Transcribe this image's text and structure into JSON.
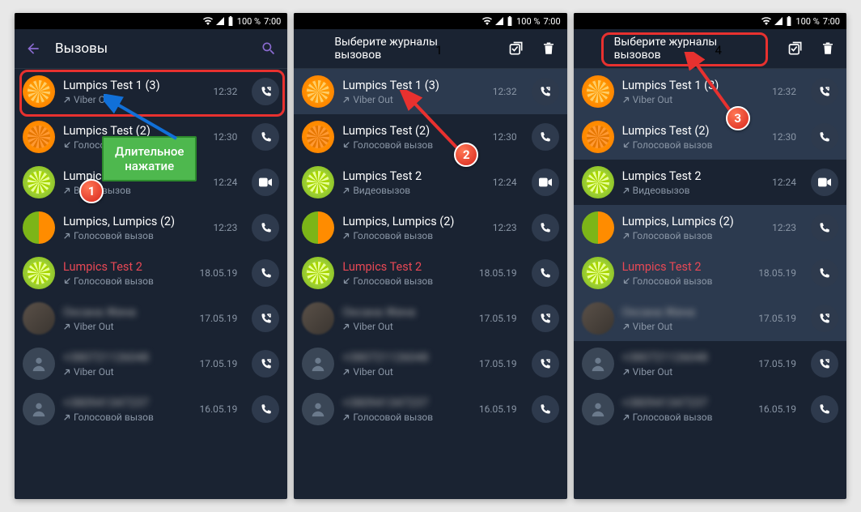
{
  "status": {
    "battery": "100 %",
    "time": "7:00"
  },
  "screens": [
    {
      "appbar": {
        "type": "calls",
        "title": "Вызовы"
      },
      "rows": [
        {
          "avatar": "orange",
          "title": "Lumpics Test 1 (3)",
          "sub": "Viber Out",
          "dir": "out",
          "time": "12:32",
          "btn": "viberout",
          "hl": true
        },
        {
          "avatar": "orange-dark",
          "title": "Lumpics Test (2)",
          "sub": "Голосовой вызов",
          "dir": "in",
          "time": "12:30",
          "btn": "call",
          "truncated": true
        },
        {
          "avatar": "lime",
          "title": "Lumpics Test 2",
          "sub": "Видеовызов",
          "dir": "out",
          "time": "12:24",
          "btn": "video",
          "truncated2": true
        },
        {
          "avatar": "half",
          "title": "Lumpics, Lumpics (2)",
          "sub": "Голосовой вызов",
          "dir": "out",
          "time": "12:23",
          "btn": "call"
        },
        {
          "avatar": "lime",
          "title": "Lumpics Test 2",
          "missed": true,
          "sub": "Голосовой вызов",
          "dir": "in",
          "time": "18.05.19",
          "btn": "call"
        },
        {
          "avatar": "photo",
          "title": "Оксана Жена",
          "blurred": true,
          "sub": "Viber Out",
          "dir": "out",
          "time": "17.05.19",
          "btn": "viberout"
        },
        {
          "avatar": "placeholder",
          "title": "+380721126048",
          "blurred": true,
          "sub": "Viber Out",
          "dir": "out",
          "time": "17.05.19",
          "btn": "viberout"
        },
        {
          "avatar": "placeholder",
          "title": "+380941347237",
          "blurred": true,
          "sub": "Голосовой вызов",
          "dir": "out",
          "time": "16.05.19",
          "btn": "call"
        }
      ]
    },
    {
      "appbar": {
        "type": "select",
        "line1": "Выберите журналы",
        "line2": "вызовов",
        "step_num": "1"
      },
      "rows": [
        {
          "avatar": "orange",
          "title": "Lumpics Test 1 (3)",
          "sub": "Viber Out",
          "dir": "out",
          "time": "12:32",
          "btn": "viberout",
          "selected": true
        },
        {
          "avatar": "orange-dark",
          "title": "Lumpics Test (2)",
          "sub": "Голосовой вызов",
          "dir": "in",
          "time": "12:30",
          "btn": "call"
        },
        {
          "avatar": "lime",
          "title": "Lumpics Test 2",
          "sub": "Видеовызов",
          "dir": "out",
          "time": "12:24",
          "btn": "video"
        },
        {
          "avatar": "half",
          "title": "Lumpics, Lumpics (2)",
          "sub": "Голосовой вызов",
          "dir": "out",
          "time": "12:23",
          "btn": "call"
        },
        {
          "avatar": "lime",
          "title": "Lumpics Test 2",
          "missed": true,
          "sub": "Голосовой вызов",
          "dir": "in",
          "time": "18.05.19",
          "btn": "call"
        },
        {
          "avatar": "photo",
          "title": "Оксана Жена",
          "blurred": true,
          "sub": "Viber Out",
          "dir": "out",
          "time": "17.05.19",
          "btn": "viberout"
        },
        {
          "avatar": "placeholder",
          "title": "+380721126048",
          "blurred": true,
          "sub": "Viber Out",
          "dir": "out",
          "time": "17.05.19",
          "btn": "viberout"
        },
        {
          "avatar": "placeholder",
          "title": "+380941347237",
          "blurred": true,
          "sub": "Голосовой вызов",
          "dir": "out",
          "time": "16.05.19",
          "btn": "call"
        }
      ]
    },
    {
      "appbar": {
        "type": "select",
        "line1": "Выберите журналы",
        "line2": "вызовов",
        "step_num": "4"
      },
      "rows": [
        {
          "avatar": "orange",
          "title": "Lumpics Test 1 (3)",
          "sub": "Viber Out",
          "dir": "out",
          "time": "12:32",
          "btn": "viberout",
          "selected": true
        },
        {
          "avatar": "orange-dark",
          "title": "Lumpics Test (2)",
          "sub": "Голосовой вызов",
          "dir": "in",
          "time": "12:30",
          "btn": "call",
          "selected": true
        },
        {
          "avatar": "lime",
          "title": "Lumpics Test 2",
          "sub": "Видеовызов",
          "dir": "out",
          "time": "12:24",
          "btn": "video"
        },
        {
          "avatar": "half",
          "title": "Lumpics, Lumpics (2)",
          "sub": "Голосовой вызов",
          "dir": "out",
          "time": "12:23",
          "btn": "call",
          "selected": true
        },
        {
          "avatar": "lime",
          "title": "Lumpics Test 2",
          "missed": true,
          "sub": "Голосовой вызов",
          "dir": "in",
          "time": "18.05.19",
          "btn": "call",
          "selected": true
        },
        {
          "avatar": "photo",
          "title": "Оксана Жена",
          "blurred": true,
          "sub": "Viber Out",
          "dir": "out",
          "time": "17.05.19",
          "btn": "viberout",
          "selected": true
        },
        {
          "avatar": "placeholder",
          "title": "+380721126048",
          "blurred": true,
          "sub": "Viber Out",
          "dir": "out",
          "time": "17.05.19",
          "btn": "viberout"
        },
        {
          "avatar": "placeholder",
          "title": "+380941347237",
          "blurred": true,
          "sub": "Голосовой вызов",
          "dir": "out",
          "time": "16.05.19",
          "btn": "call"
        }
      ]
    }
  ],
  "callout": {
    "line1": "Длительное",
    "line2": "нажатие"
  },
  "steps": [
    "1",
    "2",
    "3",
    "4"
  ]
}
